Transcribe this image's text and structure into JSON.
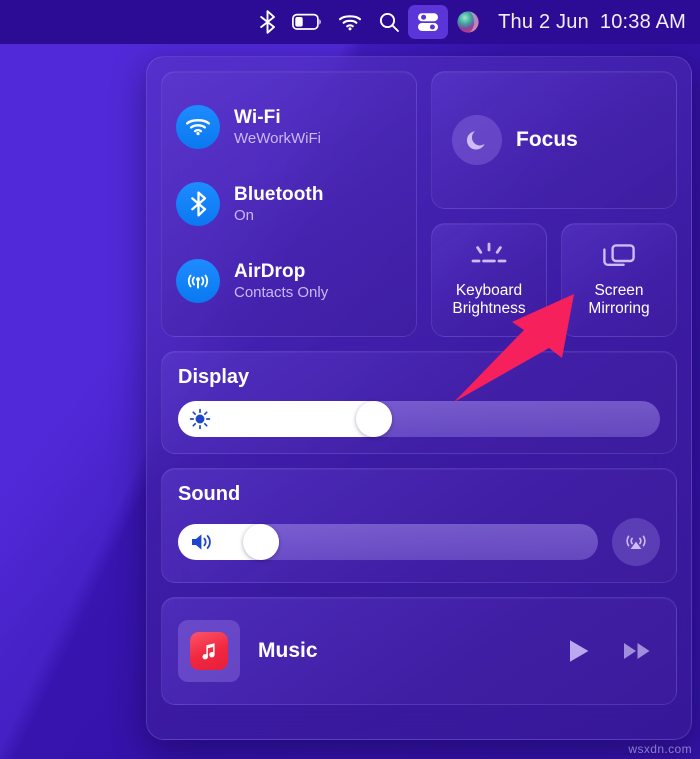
{
  "menubar": {
    "icons": [
      {
        "name": "bluetooth-icon",
        "label": "Bluetooth"
      },
      {
        "name": "battery-icon",
        "label": "Battery",
        "level_percent": 35
      },
      {
        "name": "wifi-icon",
        "label": "Wi-Fi"
      },
      {
        "name": "spotlight-search-icon",
        "label": "Spotlight Search"
      },
      {
        "name": "control-center-icon",
        "label": "Control Center",
        "active": true
      },
      {
        "name": "siri-icon",
        "label": "Siri"
      }
    ],
    "date": "Thu 2 Jun",
    "time": "10:38 AM"
  },
  "control_center": {
    "connectivity": [
      {
        "icon": "wifi-icon",
        "title": "Wi-Fi",
        "subtitle": "WeWorkWiFi"
      },
      {
        "icon": "bluetooth-icon",
        "title": "Bluetooth",
        "subtitle": "On"
      },
      {
        "icon": "airdrop-icon",
        "title": "AirDrop",
        "subtitle": "Contacts Only"
      }
    ],
    "focus": {
      "icon": "moon-icon",
      "label": "Focus"
    },
    "tiles": [
      {
        "icon": "keyboard-brightness-icon",
        "line1": "Keyboard",
        "line2": "Brightness"
      },
      {
        "icon": "screen-mirroring-icon",
        "line1": "Screen",
        "line2": "Mirroring"
      }
    ],
    "display": {
      "title": "Display",
      "icon": "brightness-sun-icon",
      "value_percent": 40
    },
    "sound": {
      "title": "Sound",
      "icon": "speaker-volume-icon",
      "value_percent": 17,
      "output_button": "airplay-icon"
    },
    "music": {
      "app_icon": "music-app-icon",
      "label": "Music",
      "controls": [
        {
          "name": "play-button",
          "label": "Play"
        },
        {
          "name": "fast-forward-button",
          "label": "Fast Forward"
        }
      ]
    }
  },
  "annotation": {
    "arrow_color": "#F6205C",
    "points_to": "Screen Mirroring"
  },
  "watermark": "wsxdn.com",
  "colors": {
    "desktop": "#4a1fd6",
    "menubar": "#2c0c95",
    "accent_blue": "#0a84ff",
    "panel_tint": "#5634c4",
    "music_red": "#f0273f",
    "arrow_pink": "#F6205C"
  }
}
